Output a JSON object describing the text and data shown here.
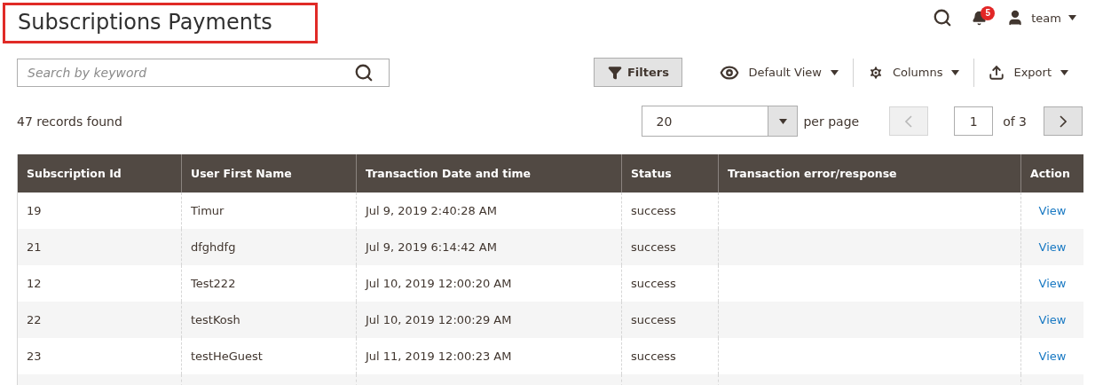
{
  "page_title": "Subscriptions Payments",
  "header": {
    "notifications": "5",
    "user": "team"
  },
  "search": {
    "placeholder": "Search by keyword"
  },
  "toolbar": [
    {
      "label": "Filters",
      "kind": "button"
    },
    {
      "label": "Default View",
      "kind": "view"
    },
    {
      "label": "Columns",
      "kind": "columns"
    },
    {
      "label": "Export",
      "kind": "export"
    }
  ],
  "records": "47 records found",
  "pagination": {
    "per_page": "20",
    "per_page_label": "per page",
    "page": "1",
    "of": "of 3",
    "prev_disabled": true,
    "next_disabled": false
  },
  "table": {
    "columns": [
      "Subscription Id",
      "User First Name",
      "Transaction Date and time",
      "Status",
      "Transaction error/response",
      "Action"
    ],
    "rows": [
      {
        "cells": [
          "19",
          "Timur",
          "Jul 9, 2019 2:40:28 AM",
          "success",
          "",
          "View"
        ]
      },
      {
        "cells": [
          "21",
          "dfghdfg",
          "Jul 9, 2019 6:14:42 AM",
          "success",
          "",
          "View"
        ]
      },
      {
        "cells": [
          "12",
          "Test222",
          "Jul 10, 2019 12:00:20 AM",
          "success",
          "",
          "View"
        ]
      },
      {
        "cells": [
          "22",
          "testKosh",
          "Jul 10, 2019 12:00:29 AM",
          "success",
          "",
          "View"
        ]
      },
      {
        "cells": [
          "23",
          "testHeGuest",
          "Jul 11, 2019 12:00:23 AM",
          "success",
          "",
          "View"
        ]
      }
    ]
  }
}
